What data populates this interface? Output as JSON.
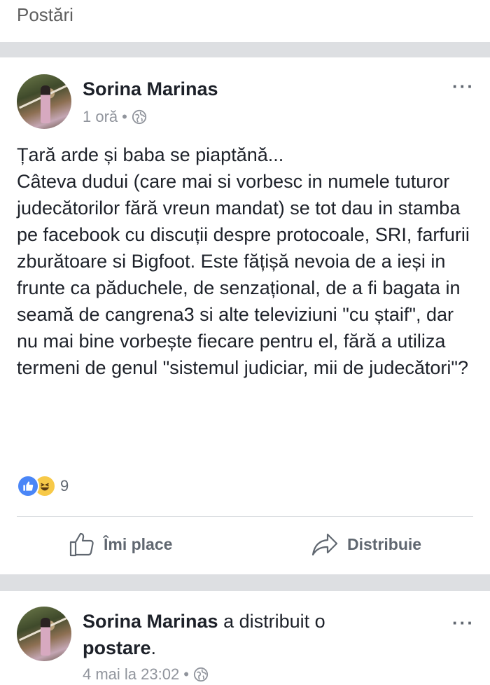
{
  "section": {
    "title": "Postări"
  },
  "post1": {
    "author": "Sorina Marinas",
    "time": "1 oră",
    "dot": "•",
    "more": "···",
    "text": "Țară arde și baba se piaptănă...\nCâteva dudui (care mai si vorbesc in numele tuturor judecătorilor fără vreun mandat) se tot dau in stamba pe facebook cu discuții despre protocoale, SRI, farfurii zburătoare si Bigfoot. Este fățișă nevoia de a ieși in frunte ca păduchele, de senzațional, de a fi bagata in seamă de cangrena3 si alte televiziuni \"cu ștaif\", dar nu mai bine vorbește fiecare pentru el, fără a utiliza termeni de genul \"sistemul judiciar, mii de judecători\"?",
    "reactions": {
      "count": "9",
      "types": [
        "like-icon",
        "haha-icon"
      ]
    },
    "actions": {
      "like": "Îmi place",
      "share": "Distribuie"
    }
  },
  "post2": {
    "author": "Sorina Marinas",
    "shared_text": "a distribuit o",
    "shared_object": "postare",
    "period": ".",
    "time": "4 mai la 23:02",
    "dot": "•",
    "more": "···"
  },
  "colors": {
    "divider": "#dddfe2",
    "meta": "#90949c",
    "like_blue": "#4a86f7",
    "haha_yellow": "#f7c948"
  }
}
